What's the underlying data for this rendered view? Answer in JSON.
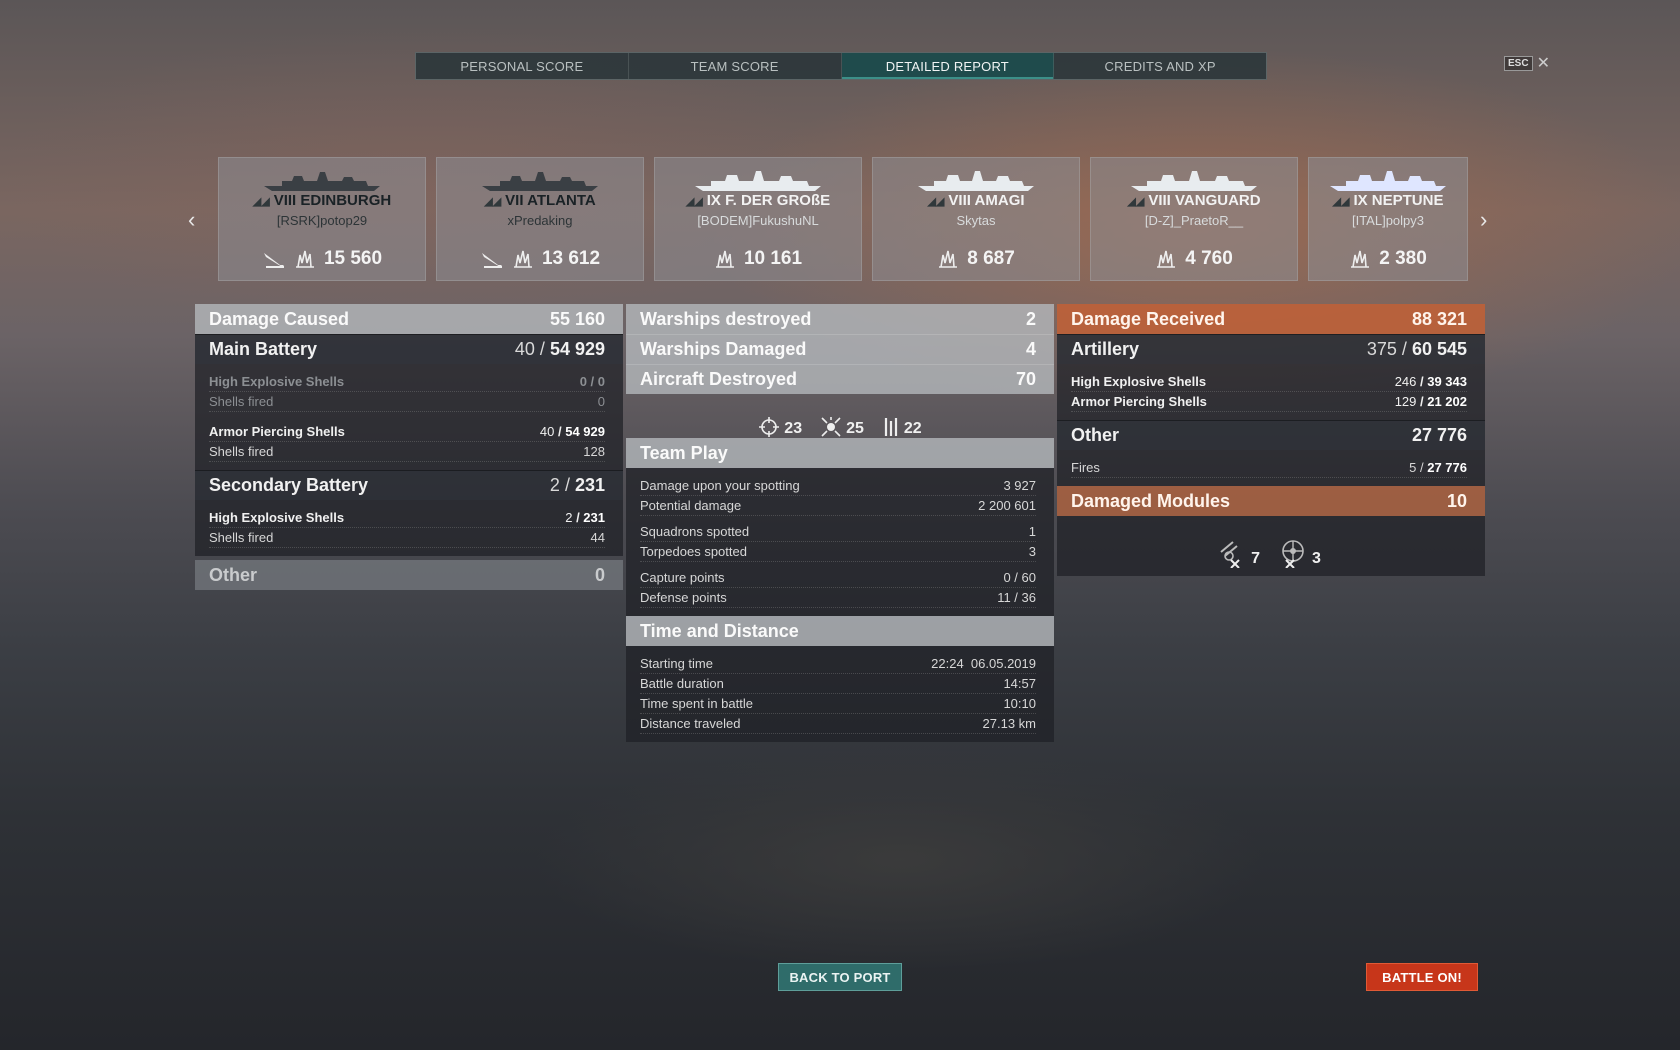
{
  "tabs": [
    "PERSONAL SCORE",
    "TEAM SCORE",
    "DETAILED REPORT",
    "CREDITS AND XP"
  ],
  "esc": {
    "key": "ESC",
    "close": "✕"
  },
  "nav": {
    "prev": "‹",
    "next": "›"
  },
  "ships": [
    {
      "tier": "VIII",
      "name": "EDINBURGH",
      "player": "[RSRK]potop29",
      "damage": "15 560",
      "torpedo": true
    },
    {
      "tier": "VII",
      "name": "ATLANTA",
      "player": "xPredaking",
      "damage": "13 612",
      "torpedo": true
    },
    {
      "tier": "IX",
      "name": "F. DER GROßE",
      "player": "[BODEM]FukushuNL",
      "damage": "10 161",
      "torpedo": false
    },
    {
      "tier": "VIII",
      "name": "AMAGI",
      "player": "Skytas",
      "damage": "8 687",
      "torpedo": false
    },
    {
      "tier": "VIII",
      "name": "VANGUARD",
      "player": "[D-Z]_PraetoR__",
      "damage": "4 760",
      "torpedo": false
    },
    {
      "tier": "IX",
      "name": "NEPTUNE",
      "player": "[ITAL]polpy3",
      "damage": "2 380",
      "torpedo": false
    }
  ],
  "damage_caused": {
    "title": "Damage Caused",
    "value": "55 160",
    "main_battery": {
      "title": "Main Battery",
      "hits": "40",
      "dmg": "54 929"
    },
    "he": {
      "label": "High Explosive Shells",
      "hits": "0",
      "dmg": "0"
    },
    "he_fired": {
      "label": "Shells fired",
      "value": "0"
    },
    "ap": {
      "label": "Armor Piercing Shells",
      "hits": "40",
      "dmg": "54 929"
    },
    "ap_fired": {
      "label": "Shells fired",
      "value": "128"
    },
    "secondary": {
      "title": "Secondary Battery",
      "hits": "2",
      "dmg": "231"
    },
    "sec_he": {
      "label": "High Explosive Shells",
      "hits": "2",
      "dmg": "231"
    },
    "sec_fired": {
      "label": "Shells fired",
      "value": "44"
    },
    "other": {
      "title": "Other",
      "value": "0"
    }
  },
  "middle": {
    "warships_destroyed": {
      "title": "Warships destroyed",
      "value": "2"
    },
    "warships_damaged": {
      "title": "Warships Damaged",
      "value": "4"
    },
    "aircraft_destroyed": {
      "title": "Aircraft Destroyed",
      "value": "70"
    },
    "aircraft_icons": [
      {
        "icon": "crosshair-icon",
        "value": "23"
      },
      {
        "icon": "burst-icon",
        "value": "25"
      },
      {
        "icon": "aa-guns-icon",
        "value": "22"
      }
    ],
    "team_play": {
      "title": "Team Play",
      "rows": [
        {
          "label": "Damage upon your spotting",
          "value": "3 927"
        },
        {
          "label": "Potential damage",
          "value": "2 200 601"
        },
        {
          "label": "Squadrons spotted",
          "value": "1"
        },
        {
          "label": "Torpedoes spotted",
          "value": "3"
        },
        {
          "label": "Capture points",
          "value": "0 / 60"
        },
        {
          "label": "Defense points",
          "value": "11 / 36"
        }
      ]
    },
    "time": {
      "title": "Time and Distance",
      "rows": [
        {
          "label": "Starting time",
          "value": "22:24  06.05.2019"
        },
        {
          "label": "Battle duration",
          "value": "14:57"
        },
        {
          "label": "Time spent in battle",
          "value": "10:10"
        },
        {
          "label": "Distance traveled",
          "value": "27.13 km"
        }
      ]
    }
  },
  "damage_received": {
    "title": "Damage Received",
    "value": "88 321",
    "artillery": {
      "title": "Artillery",
      "hits": "375",
      "dmg": "60 545"
    },
    "he": {
      "label": "High Explosive Shells",
      "hits": "246",
      "dmg": "39 343"
    },
    "ap": {
      "label": "Armor Piercing Shells",
      "hits": "129",
      "dmg": "21 202"
    },
    "other": {
      "title": "Other",
      "value": "27 776"
    },
    "fires": {
      "label": "Fires",
      "hits": "5",
      "dmg": "27 776"
    },
    "modules": {
      "title": "Damaged Modules",
      "value": "10"
    },
    "module_icons": [
      {
        "icon": "gun-module-icon",
        "value": "7"
      },
      {
        "icon": "rudder-module-icon",
        "value": "3"
      }
    ]
  },
  "buttons": {
    "back": "BACK TO PORT",
    "battle": "BATTLE ON!"
  },
  "colors": {
    "accent": "#2f6c6a",
    "battle": "#c7361a",
    "received": "#be6038"
  }
}
